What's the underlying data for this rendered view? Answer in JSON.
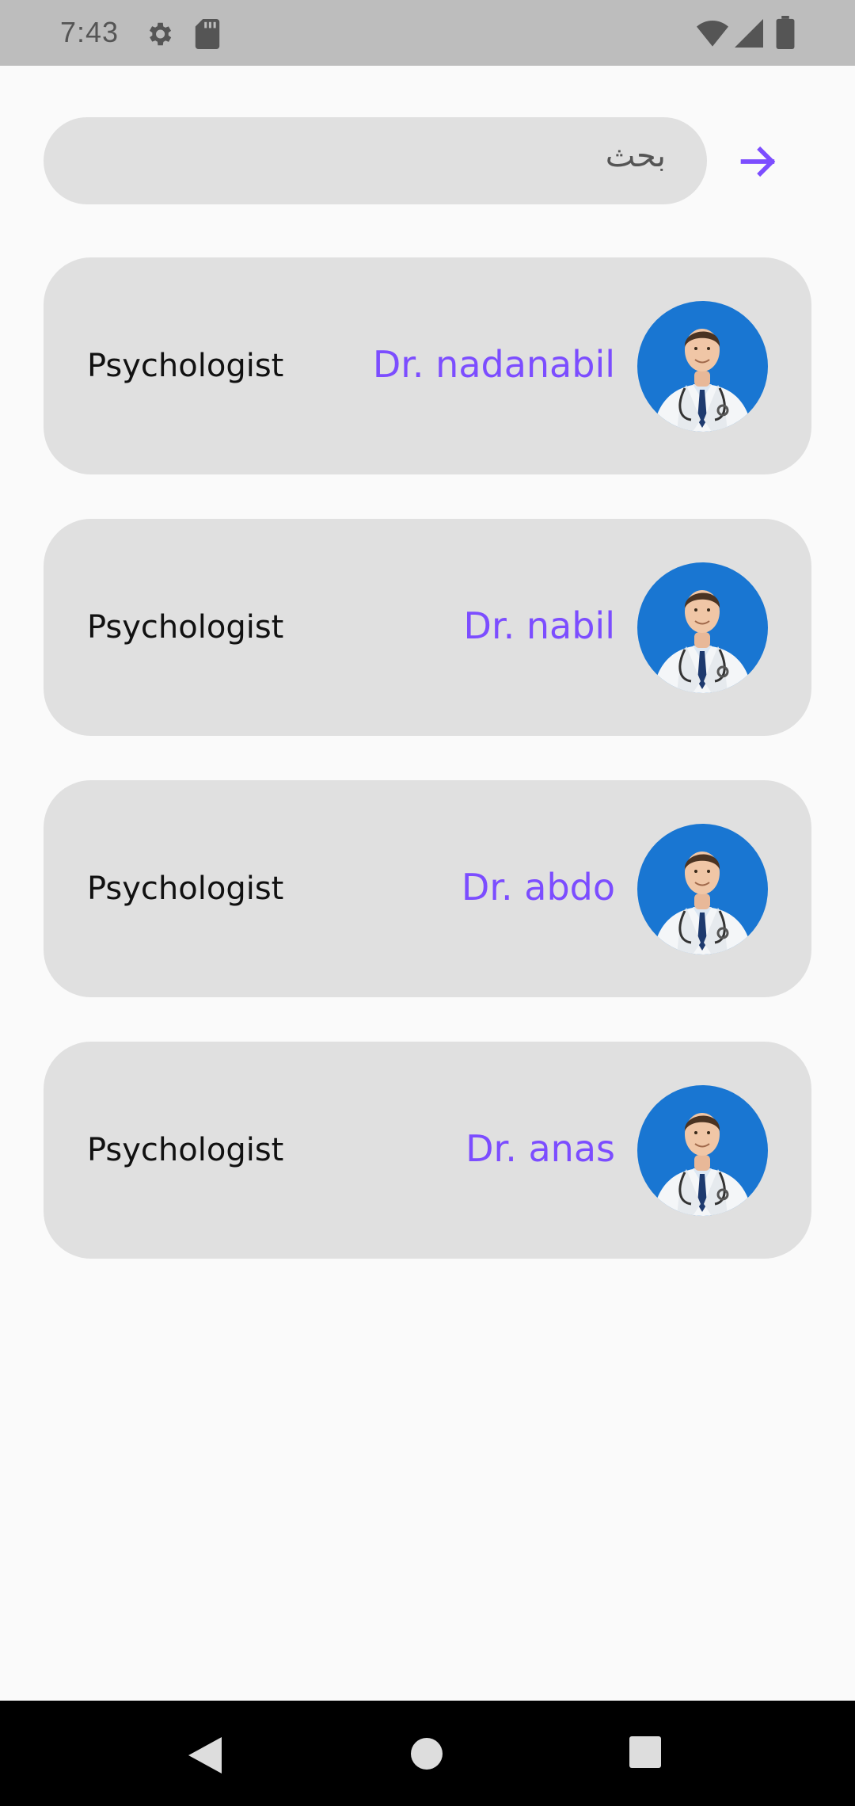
{
  "status_bar": {
    "time": "7:43",
    "icons": [
      "gear-icon",
      "sd-card-icon",
      "wifi-icon",
      "signal-icon",
      "battery-icon"
    ]
  },
  "search": {
    "placeholder": "بحث",
    "back_icon": "arrow-right-icon",
    "accent_color": "#7c4dff"
  },
  "doctors": [
    {
      "name": "Dr. nadanabil",
      "specialty": "Psychologist",
      "avatar_icon": "doctor-avatar-icon"
    },
    {
      "name": "Dr. nabil",
      "specialty": "Psychologist",
      "avatar_icon": "doctor-avatar-icon"
    },
    {
      "name": "Dr. abdo",
      "specialty": "Psychologist",
      "avatar_icon": "doctor-avatar-icon"
    },
    {
      "name": "Dr. anas",
      "specialty": "Psychologist",
      "avatar_icon": "doctor-avatar-icon"
    }
  ],
  "nav_bar": {
    "buttons": [
      "back-triangle-icon",
      "home-circle-icon",
      "recents-square-icon"
    ]
  }
}
